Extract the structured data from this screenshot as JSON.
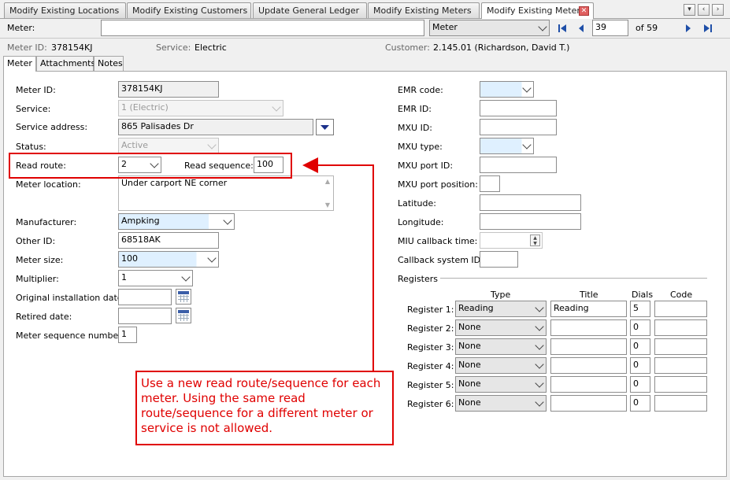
{
  "doc_tabs": [
    "Modify Existing Locations",
    "Modify Existing Customers",
    "Update General Ledger",
    "Modify Existing Meters",
    "Modify Existing Meters"
  ],
  "toolbar": {
    "label": "Meter:",
    "search_value": "",
    "search_type": "Meter",
    "record_current": "39",
    "record_total": "of 59"
  },
  "summary": {
    "meter_id_label": "Meter ID:",
    "meter_id_value": "378154KJ",
    "service_label": "Service:",
    "service_value": "Electric",
    "customer_label": "Customer:",
    "customer_value": "2.145.01  (Richardson, David T.)"
  },
  "sub_tabs": [
    "Meter",
    "Attachments",
    "Notes"
  ],
  "left_form": {
    "meter_id_label": "Meter ID:",
    "meter_id": "378154KJ",
    "service_label": "Service:",
    "service": "1 (Electric)",
    "address_label": "Service address:",
    "address": "865 Palisades Dr",
    "status_label": "Status:",
    "status": "Active",
    "read_route_label": "Read route:",
    "read_route": "2",
    "read_sequence_label": "Read sequence:",
    "read_sequence": "100",
    "location_label": "Meter location:",
    "location": "Under carport NE corner",
    "manufacturer_label": "Manufacturer:",
    "manufacturer": "Ampking",
    "other_id_label": "Other ID:",
    "other_id": "68518AK",
    "meter_size_label": "Meter size:",
    "meter_size": "100",
    "multiplier_label": "Multiplier:",
    "multiplier": "1",
    "install_date_label": "Original installation date:",
    "install_date": "",
    "retired_label": "Retired date:",
    "retired": "",
    "seq_num_label": "Meter sequence number:",
    "seq_num": "1"
  },
  "right_form": {
    "emr_code_label": "EMR code:",
    "emr_id_label": "EMR ID:",
    "mxu_id_label": "MXU ID:",
    "mxu_type_label": "MXU type:",
    "mxu_port_id_label": "MXU port ID:",
    "mxu_port_pos_label": "MXU port position:",
    "latitude_label": "Latitude:",
    "longitude_label": "Longitude:",
    "miu_label": "MIU callback time:",
    "callback_label": "Callback system ID:"
  },
  "registers": {
    "section_label": "Registers",
    "col_type": "Type",
    "col_title": "Title",
    "col_dials": "Dials",
    "col_code": "Code",
    "rows": [
      {
        "label": "Register 1:",
        "type": "Reading",
        "title": "Reading",
        "dials": "5",
        "code": ""
      },
      {
        "label": "Register 2:",
        "type": "None",
        "title": "",
        "dials": "0",
        "code": ""
      },
      {
        "label": "Register 3:",
        "type": "None",
        "title": "",
        "dials": "0",
        "code": ""
      },
      {
        "label": "Register 4:",
        "type": "None",
        "title": "",
        "dials": "0",
        "code": ""
      },
      {
        "label": "Register 5:",
        "type": "None",
        "title": "",
        "dials": "0",
        "code": ""
      },
      {
        "label": "Register 6:",
        "type": "None",
        "title": "",
        "dials": "0",
        "code": ""
      }
    ]
  },
  "callout": {
    "text": "Use a new read route/sequence for each meter. Using the same read route/sequence for a different meter or service is not allowed.",
    "color": "#e00000"
  },
  "colors": {
    "highlight": "#e00000",
    "field_tint": "#dff0ff",
    "nav_blue": "#1f4fa8"
  }
}
